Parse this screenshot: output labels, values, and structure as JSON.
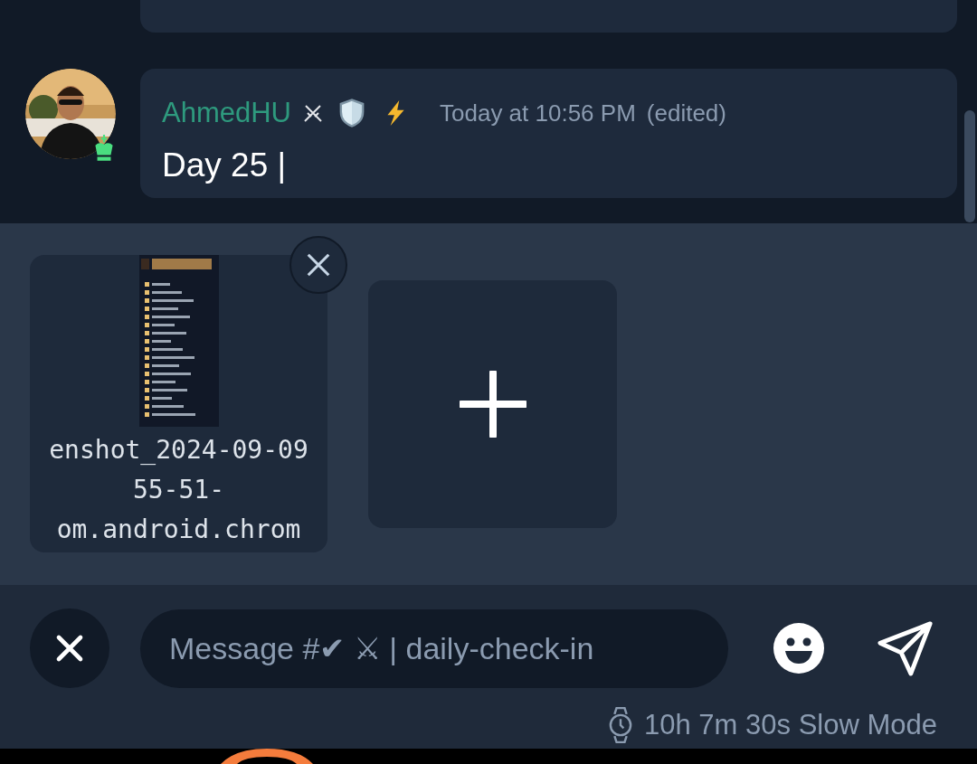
{
  "message": {
    "author": "AhmedHU",
    "timestamp": "Today at 10:56 PM",
    "edited": "(edited)",
    "text": "Day 25 |"
  },
  "attachments": [
    {
      "kind": "file",
      "filename_lines": [
        "enshot_2024-09-09",
        "55-51-",
        "om.android.chrom"
      ]
    },
    {
      "kind": "add"
    }
  ],
  "composer": {
    "placeholder": "Message #✔ ⚔ | daily-check-in"
  },
  "slow_mode": "10h 7m 30s Slow Mode"
}
